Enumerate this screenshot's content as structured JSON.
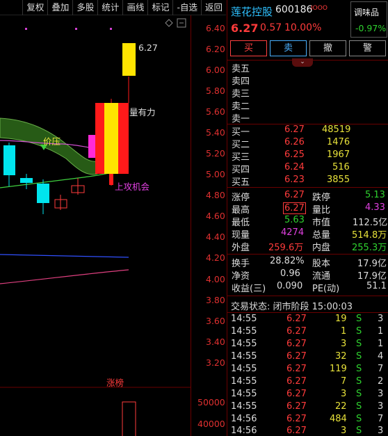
{
  "toolbar": {
    "buttons": [
      "复权",
      "叠加",
      "多股",
      "统计",
      "画线",
      "标记",
      "-自选",
      "返回"
    ]
  },
  "chart": {
    "price_labels": [
      "6.40",
      "6.20",
      "6.00",
      "5.80",
      "5.60",
      "5.40",
      "5.20",
      "5.00",
      "4.80",
      "4.60",
      "4.40",
      "4.20",
      "4.00",
      "3.80",
      "3.60",
      "3.40",
      "3.20"
    ],
    "volume_labels": [
      "50000",
      "40000"
    ],
    "annotations": {
      "high_price": "6.27",
      "volume_power": "量有力",
      "price_pressure": "价压",
      "attack": "上攻机会",
      "limit_up": "涨榜"
    },
    "colors": {
      "up": "#ff1a1a",
      "down": "#00e5ee",
      "limit": "#ffe400",
      "band": "#2e6b1a"
    }
  },
  "quote": {
    "name": "莲花控股",
    "code": "600186",
    "code_sup": "IOOO",
    "price": "6.27",
    "change": "0.57",
    "change_pct": "10.00%",
    "sector": {
      "name": "调味品",
      "pct": "-0.97%"
    }
  },
  "trade_buttons": {
    "buy": "买",
    "sell": "卖",
    "cancel": "撤",
    "alert": "警"
  },
  "fold_icon": "⌄",
  "asks": [
    {
      "label": "卖五",
      "price": "",
      "vol": ""
    },
    {
      "label": "卖四",
      "price": "",
      "vol": ""
    },
    {
      "label": "卖三",
      "price": "",
      "vol": ""
    },
    {
      "label": "卖二",
      "price": "",
      "vol": ""
    },
    {
      "label": "卖一",
      "price": "",
      "vol": ""
    }
  ],
  "bids": [
    {
      "label": "买一",
      "price": "6.27",
      "vol": "48519"
    },
    {
      "label": "买二",
      "price": "6.26",
      "vol": "1476"
    },
    {
      "label": "买三",
      "price": "6.25",
      "vol": "1967"
    },
    {
      "label": "买四",
      "price": "6.24",
      "vol": "516"
    },
    {
      "label": "买五",
      "price": "6.23",
      "vol": "3855"
    }
  ],
  "stats": [
    {
      "l1": "涨停",
      "v1": "6.27",
      "l2": "跌停",
      "v2": "5.13"
    },
    {
      "l1": "最高",
      "v1": "6.27",
      "l2": "量比",
      "v2": "4.33"
    },
    {
      "l1": "最低",
      "v1": "5.63",
      "l2": "市值",
      "v2": "112.5亿"
    },
    {
      "l1": "现量",
      "v1": "4274",
      "l2": "总量",
      "v2": "514.8万"
    },
    {
      "l1": "外盘",
      "v1": "259.6万",
      "l2": "内盘",
      "v2": "255.3万"
    }
  ],
  "stats2": [
    {
      "l1": "换手",
      "v1": "28.82%",
      "l2": "股本",
      "v2": "17.9亿"
    },
    {
      "l1": "净资",
      "v1": "0.96",
      "l2": "流通",
      "v2": "17.9亿"
    },
    {
      "l1": "收益(三)",
      "v1": "0.090",
      "l2": "PE(动)",
      "v2": "51.1"
    }
  ],
  "trade_status": "交易状态: 闭市阶段 15:00:03",
  "ticks": [
    {
      "time": "14:55",
      "price": "6.27",
      "vol": "19",
      "side": "S",
      "count": "3"
    },
    {
      "time": "14:55",
      "price": "6.27",
      "vol": "1",
      "side": "S",
      "count": "1"
    },
    {
      "time": "14:55",
      "price": "6.27",
      "vol": "3",
      "side": "S",
      "count": "1"
    },
    {
      "time": "14:55",
      "price": "6.27",
      "vol": "32",
      "side": "S",
      "count": "4"
    },
    {
      "time": "14:55",
      "price": "6.27",
      "vol": "119",
      "side": "S",
      "count": "7"
    },
    {
      "time": "14:55",
      "price": "6.27",
      "vol": "7",
      "side": "S",
      "count": "2"
    },
    {
      "time": "14:55",
      "price": "6.27",
      "vol": "3",
      "side": "S",
      "count": "3"
    },
    {
      "time": "14:55",
      "price": "6.27",
      "vol": "22",
      "side": "S",
      "count": "3"
    },
    {
      "time": "14:56",
      "price": "6.27",
      "vol": "484",
      "side": "S",
      "count": "7"
    },
    {
      "time": "14:56",
      "price": "6.27",
      "vol": "3",
      "side": "S",
      "count": "3"
    }
  ]
}
